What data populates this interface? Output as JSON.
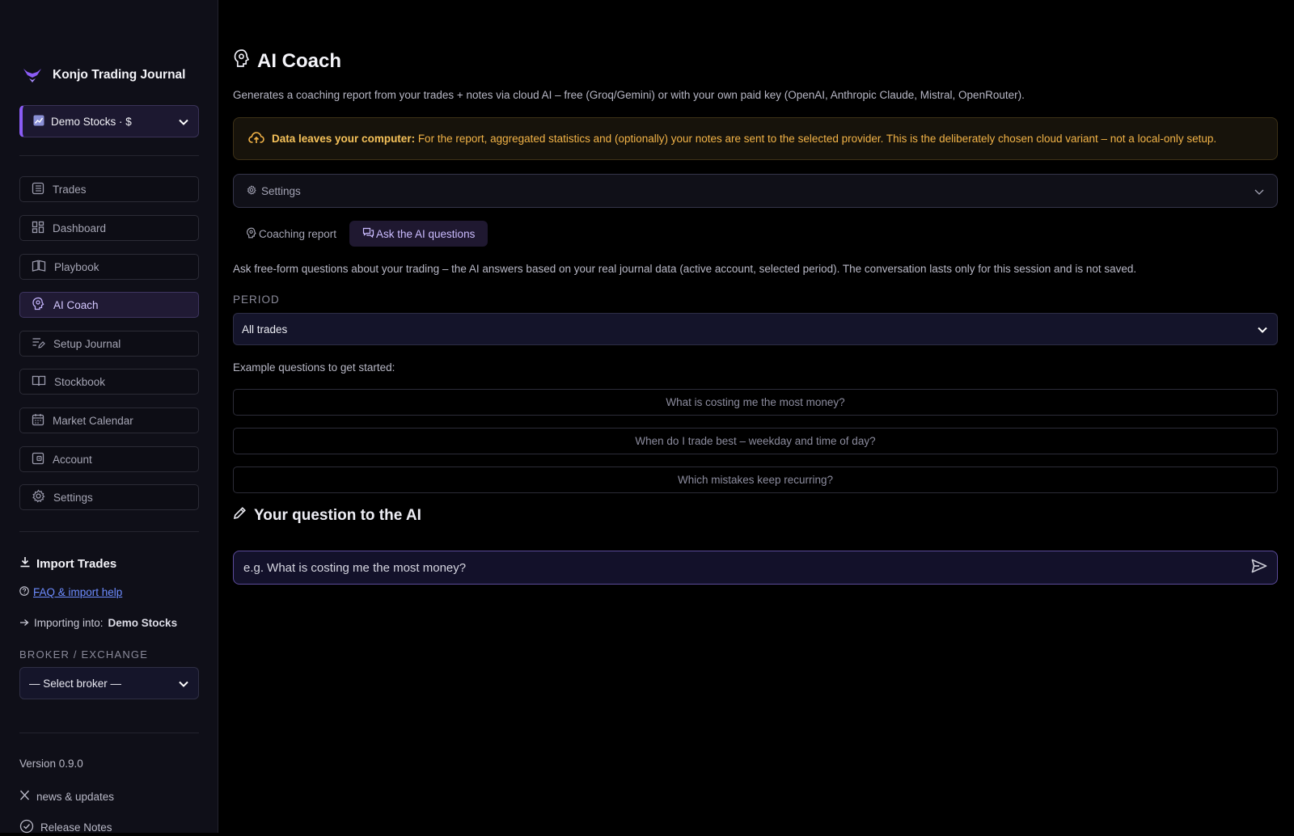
{
  "app": {
    "name": "Konjo Trading Journal",
    "accent": "#8b5cf6",
    "warning_color": "#f2b347",
    "link_color": "#6d8cff"
  },
  "account_selector": {
    "value": "Demo Stocks · $",
    "icon": "chart-icon"
  },
  "sidebar": {
    "nav": [
      {
        "label": "Trades",
        "icon": "list-icon"
      },
      {
        "label": "Dashboard",
        "icon": "grid-icon"
      },
      {
        "label": "Playbook",
        "icon": "book-open-icon"
      },
      {
        "label": "AI Coach",
        "icon": "brain-icon",
        "active": true
      },
      {
        "label": "Setup Journal",
        "icon": "list-edit-icon"
      },
      {
        "label": "Stockbook",
        "icon": "book-icon"
      },
      {
        "label": "Market Calendar",
        "icon": "calendar-icon"
      },
      {
        "label": "Account",
        "icon": "wallet-icon"
      },
      {
        "label": "Settings",
        "icon": "gear-icon"
      }
    ],
    "import": {
      "title": "Import Trades",
      "faq_link": "FAQ & import help",
      "importing_prefix": "Importing into:",
      "importing_account": "Demo Stocks",
      "broker_label": "BROKER / EXCHANGE",
      "broker_select": "— Select broker —"
    },
    "footer": {
      "version": "Version 0.9.0",
      "news": "news & updates",
      "release_notes": "Release Notes"
    }
  },
  "main": {
    "title": "AI Coach",
    "description": "Generates a coaching report from your trades + notes via cloud AI – free (Groq/Gemini) or with your own paid key (OpenAI, Anthropic Claude, Mistral, OpenRouter).",
    "warning": {
      "bold": "Data leaves your computer:",
      "text": " For the report, aggregated statistics and (optionally) your notes are sent to the selected provider. This is the deliberately chosen cloud variant – not a local-only setup."
    },
    "settings_label": "Settings",
    "tabs": [
      {
        "label": "Coaching report",
        "icon": "brain-icon"
      },
      {
        "label": "Ask the AI questions",
        "icon": "chat-icon",
        "active": true
      }
    ],
    "intro": "Ask free-form questions about your trading – the AI answers based on your real journal data (active account, selected period). The conversation lasts only for this session and is not saved.",
    "period_label": "PERIOD",
    "period_value": "All trades",
    "examples_label": "Example questions to get started:",
    "examples": [
      "What is costing me the most money?",
      "When do I trade best – weekday and time of day?",
      "Which mistakes keep recurring?"
    ],
    "question_heading": "Your question to the AI",
    "question_placeholder": "e.g. What is costing me the most money?"
  }
}
